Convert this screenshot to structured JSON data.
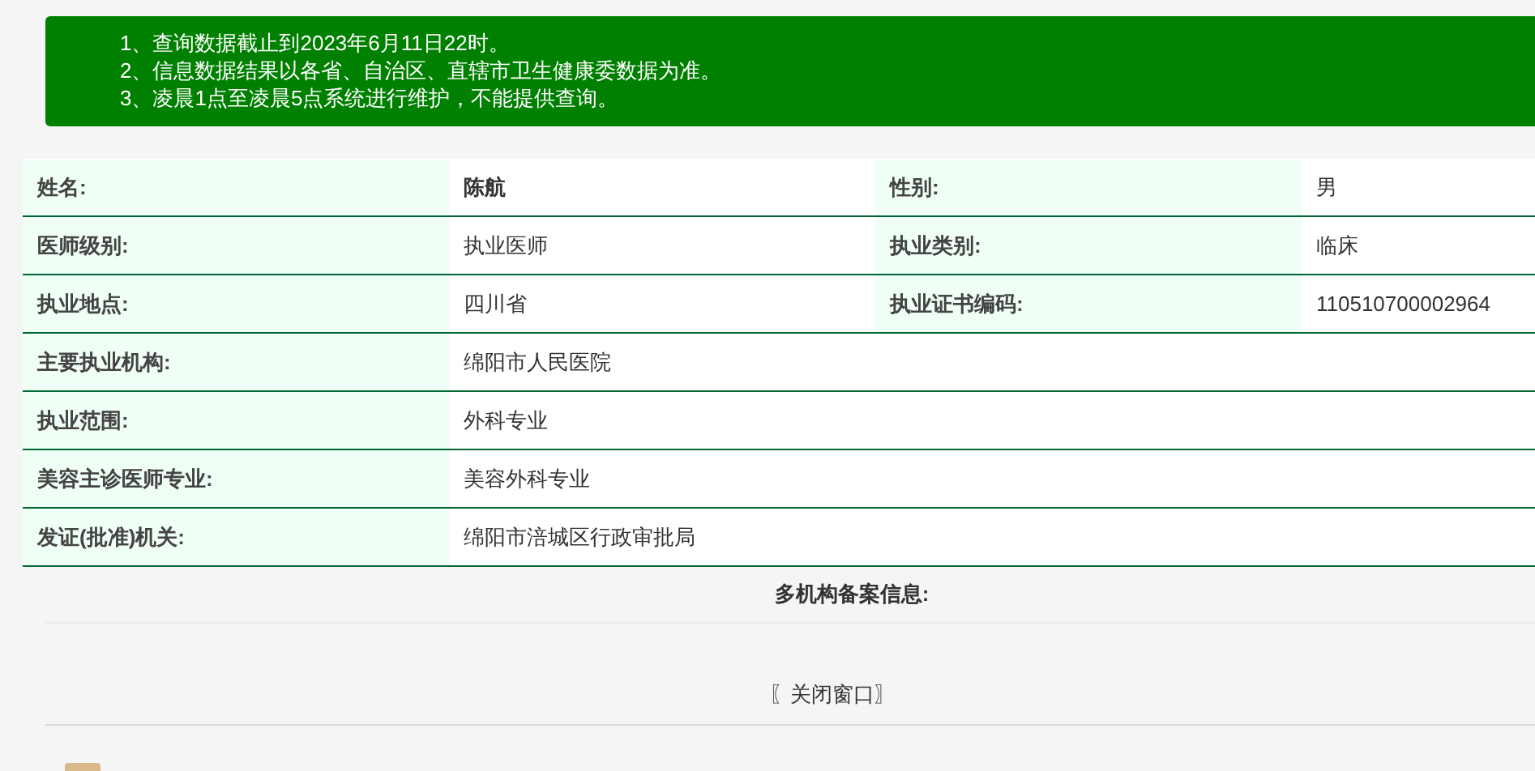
{
  "notices": [
    "1、查询数据截止到2023年6月11日22时。",
    "2、信息数据结果以各省、自治区、直辖市卫生健康委数据为准。",
    "3、凌晨1点至凌晨5点系统进行维护，不能提供查询。"
  ],
  "rows": [
    [
      {
        "label": "姓名:",
        "value": "陈航",
        "bold": true
      },
      {
        "label": "性别:",
        "value": "男",
        "bold": false
      }
    ],
    [
      {
        "label": "医师级别:",
        "value": "执业医师",
        "bold": false
      },
      {
        "label": "执业类别:",
        "value": "临床",
        "bold": false
      }
    ],
    [
      {
        "label": "执业地点:",
        "value": "四川省",
        "bold": false
      },
      {
        "label": "执业证书编码:",
        "value": "110510700002964",
        "bold": false
      }
    ],
    [
      {
        "label": "主要执业机构:",
        "value": "绵阳市人民医院",
        "bold": false
      }
    ],
    [
      {
        "label": "执业范围:",
        "value": "外科专业",
        "bold": false
      }
    ],
    [
      {
        "label": "美容主诊医师专业:",
        "value": "美容外科专业",
        "bold": false
      }
    ],
    [
      {
        "label": "发证(批准)机关:",
        "value": "绵阳市涪城区行政审批局",
        "bold": false
      }
    ]
  ],
  "multi_org_heading": "多机构备案信息:",
  "close_link": "〖关闭窗口〗"
}
